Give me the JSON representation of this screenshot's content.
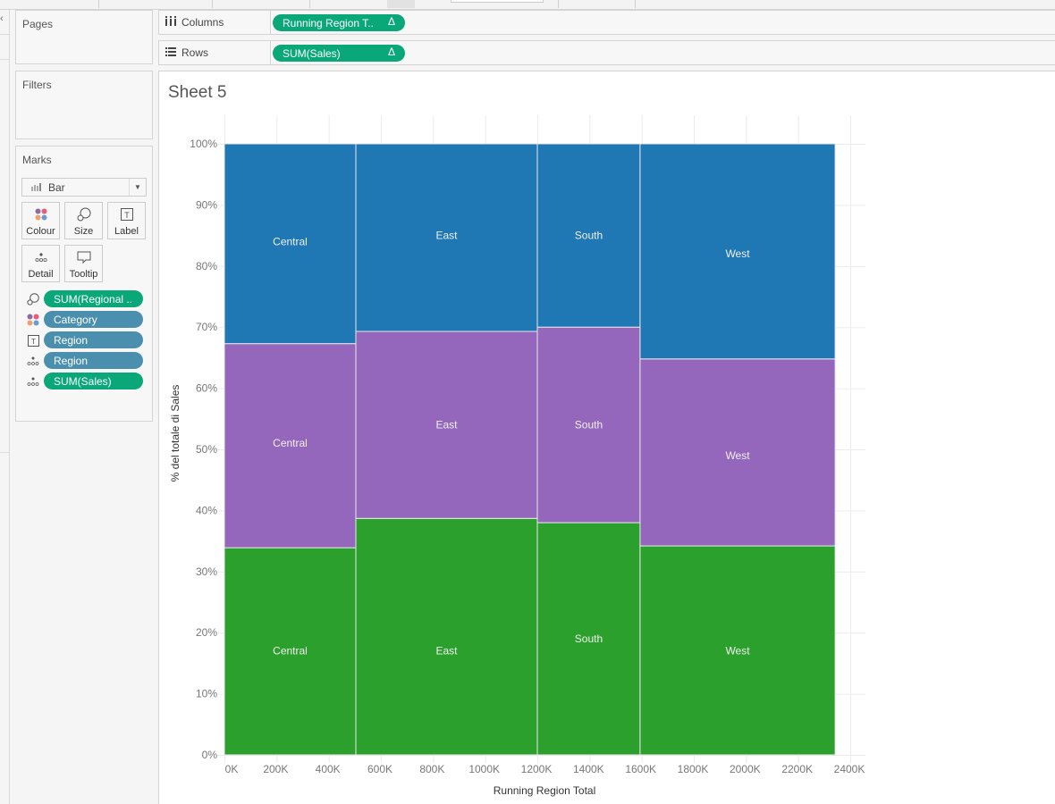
{
  "shelves": {
    "pages_label": "Pages",
    "filters_label": "Filters",
    "columns": {
      "label": "Columns",
      "pill": "Running Region T..",
      "pill_suffix": "Δ"
    },
    "rows": {
      "label": "Rows",
      "pill": "SUM(Sales)",
      "pill_suffix": "Δ"
    }
  },
  "marks": {
    "title": "Marks",
    "mark_type": "Bar",
    "buttons": [
      {
        "label": "Colour",
        "icon": "color-dots-icon"
      },
      {
        "label": "Size",
        "icon": "size-icon"
      },
      {
        "label": "Label",
        "icon": "label-icon"
      },
      {
        "label": "Detail",
        "icon": "detail-icon"
      },
      {
        "label": "Tooltip",
        "icon": "tooltip-icon"
      }
    ],
    "fields": [
      {
        "icon": "size-icon",
        "label": "SUM(Regional ..",
        "kind": "measure"
      },
      {
        "icon": "color-dots-icon",
        "label": "Category",
        "kind": "dimension"
      },
      {
        "icon": "label-icon",
        "label": "Region",
        "kind": "dimension"
      },
      {
        "icon": "detail-icon",
        "label": "Region",
        "kind": "dimension"
      },
      {
        "icon": "detail-icon",
        "label": "SUM(Sales)",
        "kind": "measure"
      }
    ]
  },
  "colors": {
    "measure_pill": "#0aa879",
    "dimension_pill": "#4a90ae",
    "series": [
      "#2ca02c",
      "#9467bd",
      "#1f77b4"
    ]
  },
  "sheet": {
    "title": "Sheet 5"
  },
  "chart_data": {
    "type": "bar",
    "subtype": "marimekko (variable-width 100% stacked bars)",
    "title": "Sheet 5",
    "xlabel": "Running Region Total",
    "ylabel": "% del totale di Sales",
    "xlim": [
      0,
      2400
    ],
    "x_units": "K",
    "ylim": [
      0,
      100
    ],
    "x_ticks": [
      "0K",
      "200K",
      "400K",
      "600K",
      "800K",
      "1000K",
      "1200K",
      "1400K",
      "1600K",
      "1800K",
      "2000K",
      "2200K",
      "2400K"
    ],
    "y_ticks": [
      "0%",
      "10%",
      "20%",
      "30%",
      "40%",
      "50%",
      "60%",
      "70%",
      "80%",
      "90%",
      "100%"
    ],
    "grid": true,
    "legend": "none",
    "categories": [
      "Central",
      "East",
      "South",
      "West"
    ],
    "x_start": [
      0,
      504,
      1200,
      1594
    ],
    "x_end": [
      504,
      1200,
      1594,
      2342
    ],
    "series": [
      {
        "name": "Series 1 (green)",
        "values": [
          33.9,
          38.7,
          38.0,
          34.2
        ]
      },
      {
        "name": "Series 2 (purple)",
        "values": [
          33.4,
          30.6,
          32.0,
          30.6
        ]
      },
      {
        "name": "Series 3 (blue)",
        "values": [
          32.7,
          30.7,
          30.0,
          35.2
        ]
      }
    ],
    "label_y_pct": [
      [
        17,
        17,
        19,
        17
      ],
      [
        51,
        54,
        54,
        49
      ],
      [
        84,
        85,
        85,
        82
      ]
    ]
  }
}
